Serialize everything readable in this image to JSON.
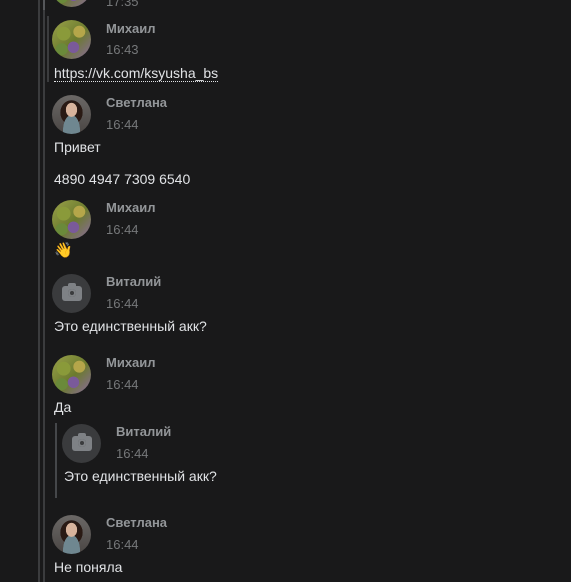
{
  "top_partial": {
    "time": "17:35"
  },
  "messages": [
    {
      "author": "Михаил",
      "time": "16:43",
      "link": "https://vk.com/ksyusha_bs"
    },
    {
      "author": "Светлана",
      "time": "16:44",
      "lines": [
        "Привет",
        "4890 4947 7309 6540"
      ]
    },
    {
      "author": "Михаил",
      "time": "16:44",
      "emoji": "👋"
    },
    {
      "author": "Виталий",
      "time": "16:44",
      "text": "Это единственный акк?"
    },
    {
      "author": "Михаил",
      "time": "16:44",
      "text": "Да",
      "quote": {
        "author": "Виталий",
        "time": "16:44",
        "text": "Это единственный акк?"
      }
    },
    {
      "author": "Светлана",
      "time": "16:44",
      "text": "Не поняла"
    }
  ]
}
